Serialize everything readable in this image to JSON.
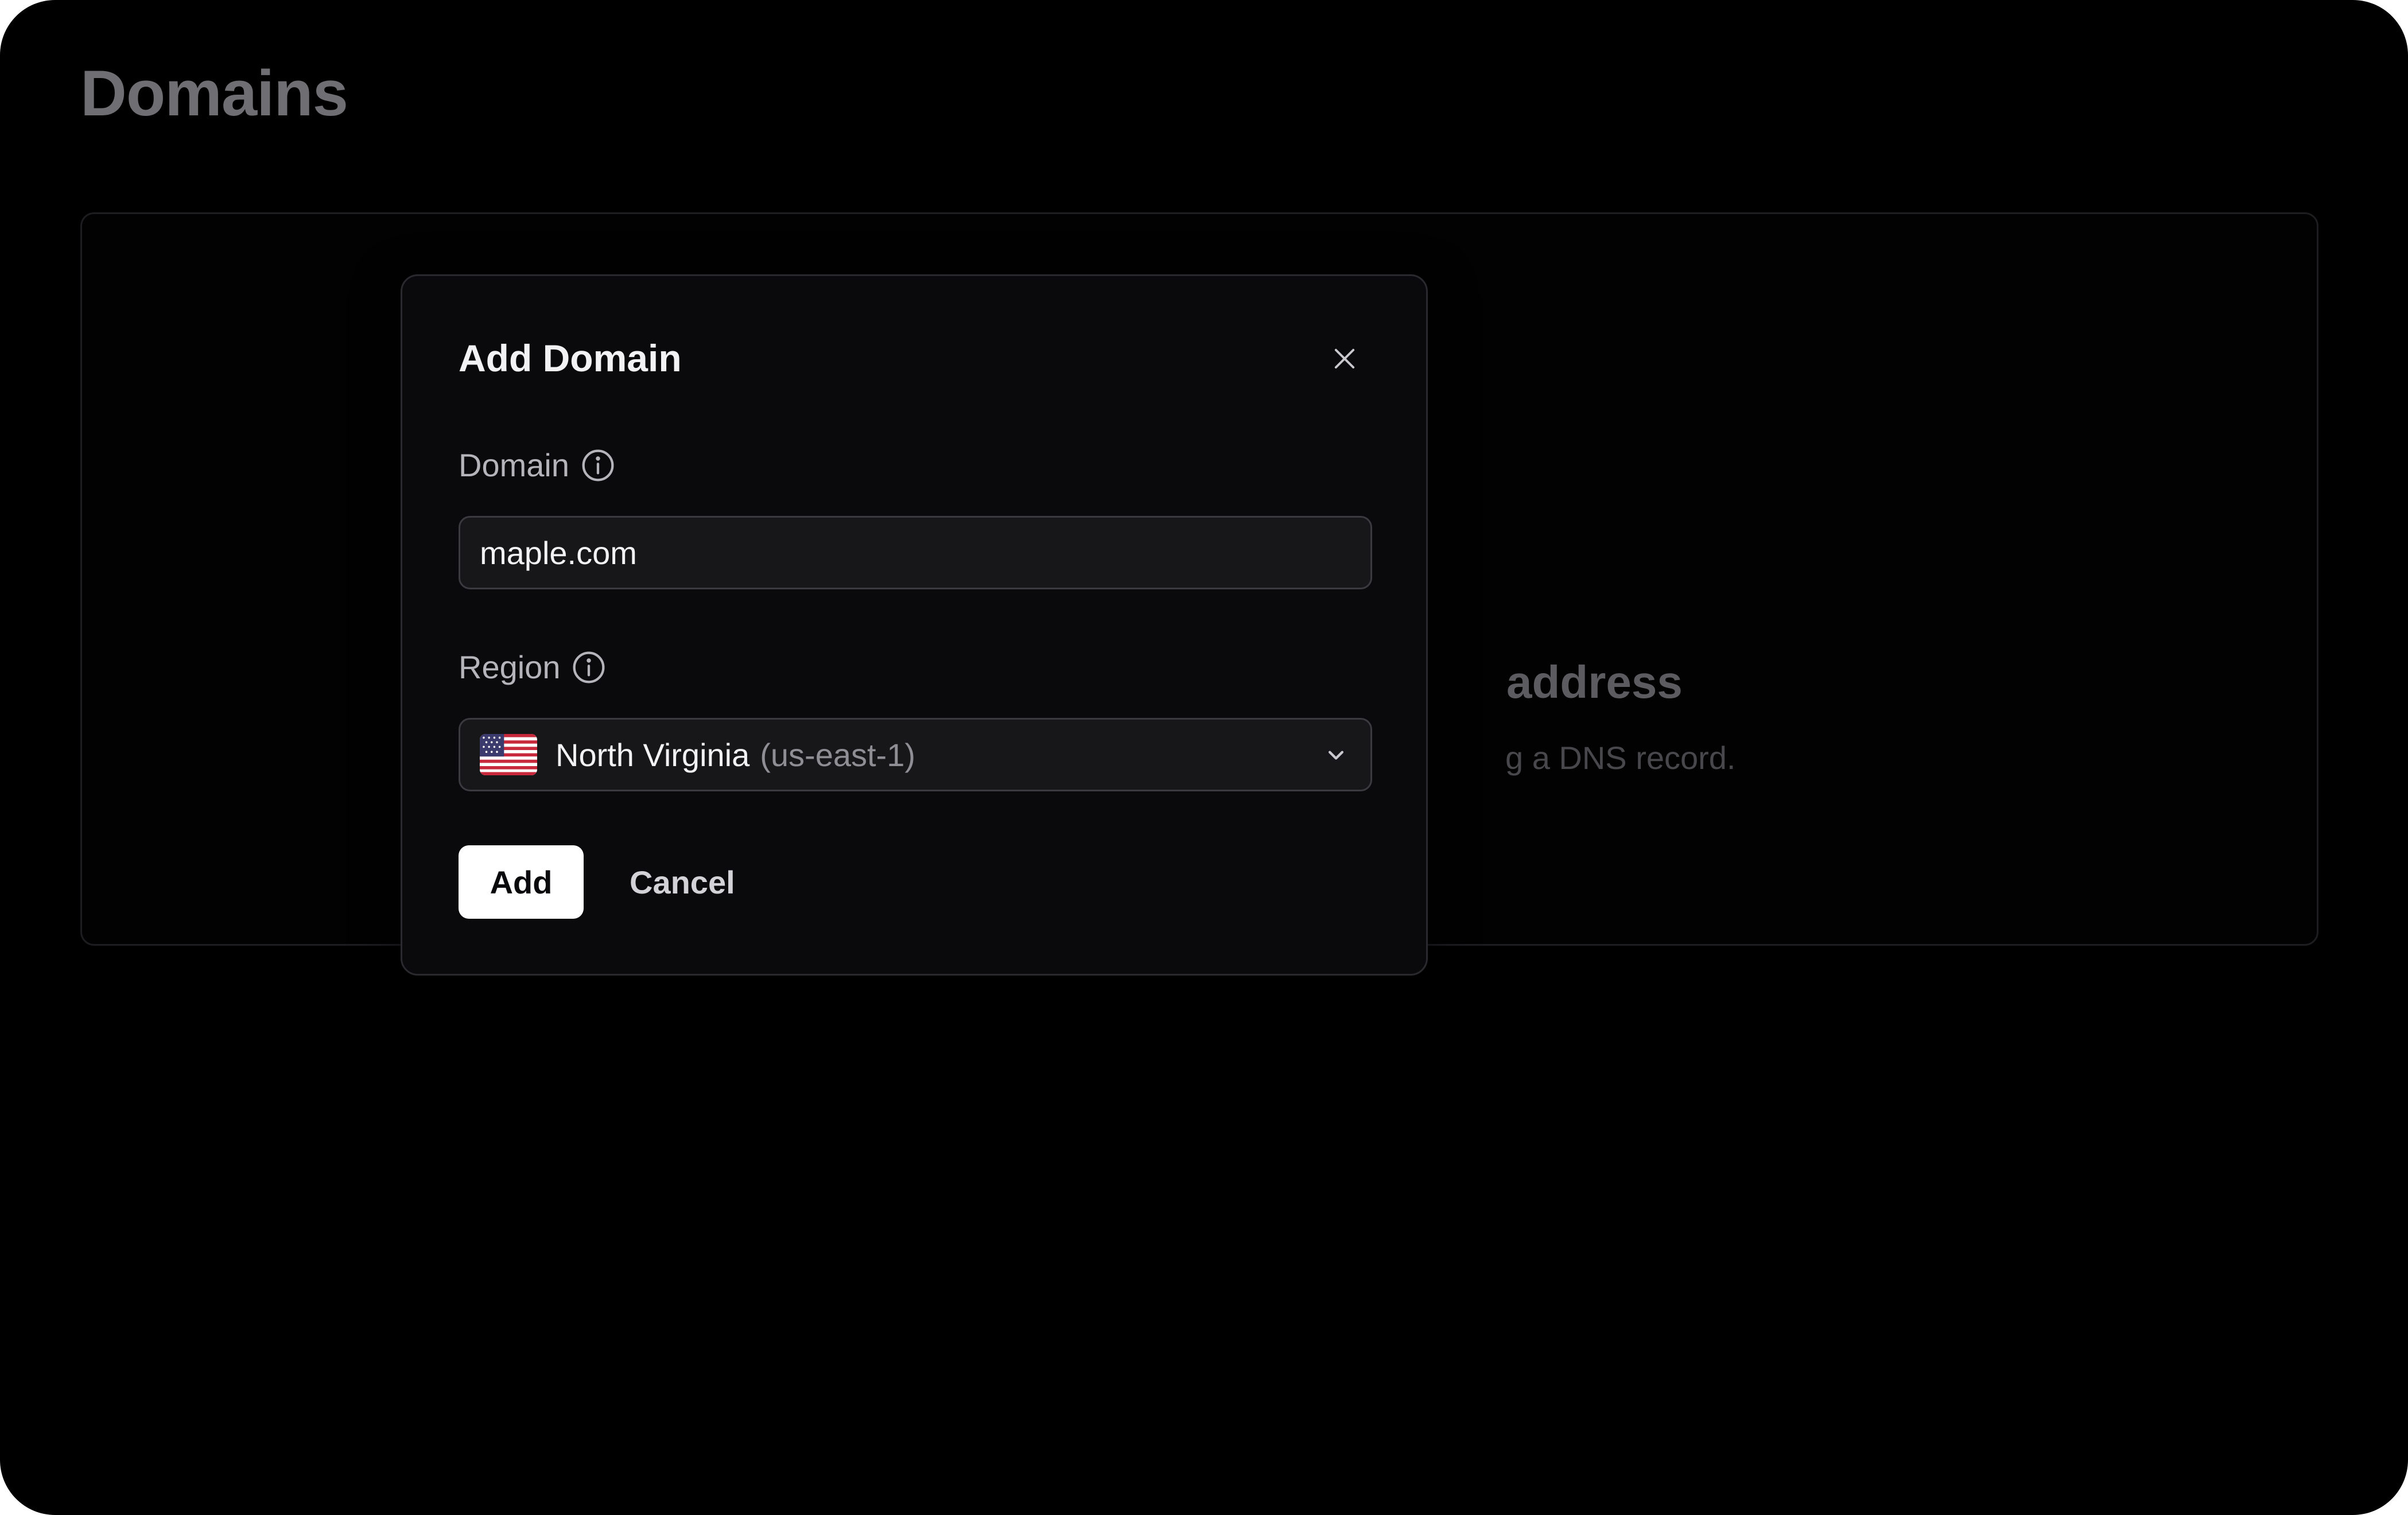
{
  "page": {
    "title": "Domains"
  },
  "background_card": {
    "heading_partial": "address",
    "sub_partial": "g a DNS record."
  },
  "modal": {
    "title": "Add Domain",
    "close_icon": "close-icon",
    "domain_field": {
      "label": "Domain",
      "info_icon": "info-icon",
      "value": "maple.com",
      "placeholder": ""
    },
    "region_field": {
      "label": "Region",
      "info_icon": "info-icon",
      "selected_name": "North Virginia",
      "selected_code": "(us-east-1)",
      "flag_icon": "us-flag-icon",
      "chevron_icon": "chevron-down-icon"
    },
    "actions": {
      "add_label": "Add",
      "cancel_label": "Cancel"
    }
  },
  "colors": {
    "background": "#000000",
    "modal_bg": "#0a0a0c",
    "input_bg": "#17171a",
    "primary_button_bg": "#ffffff",
    "primary_button_text": "#0a0a0c"
  }
}
